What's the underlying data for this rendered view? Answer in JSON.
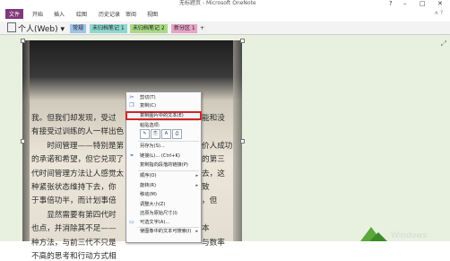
{
  "window": {
    "title": "无标题页 - Microsoft OneNote",
    "controls": [
      "?",
      "–",
      "□",
      "✕"
    ]
  },
  "ribbon": {
    "tabs": [
      "文件",
      "开始",
      "插入",
      "绘图",
      "历史记录",
      "审阅",
      "视图"
    ],
    "right_icons": "∧ ?"
  },
  "notebook": {
    "name": "个人(Web)",
    "sections": [
      {
        "label": "常规",
        "color": "#9fc3e8"
      },
      {
        "label": "未归档笔记 1",
        "color": "#8ed7cf"
      },
      {
        "label": "未归档笔记 2",
        "color": "#a9d986"
      },
      {
        "label": "新分区 1",
        "color": "#e6a4c8"
      },
      {
        "label": "+",
        "color": "#f0f0f0"
      }
    ]
  },
  "book": {
    "lines": [
      "我。但我们却发现，受过",
      "有接受过训练的人一样出色",
      "　　时间管理——特别是第",
      "的承诺和希望，但它兑现了",
      "代时间管理方法让人感觉太",
      "种紧张状态维持下去，你",
      "于事倍功半，而计划事倍",
      "　　显然需要有第四代时",
      "也点，并消除其不足——",
      "种方法，与前三代不只是",
      "不高的思考和行动方式相"
    ],
    "right_lines": [
      "能和没",
      "",
      "价人成功",
      "的第三",
      "去，这",
      "致",
      "，但",
      "",
      "本",
      "与数率",
      ""
    ]
  },
  "context_menu": {
    "items": [
      {
        "icon": "cut-icon",
        "glyph": "✂",
        "label": "剪切(T)",
        "disabled": false
      },
      {
        "icon": "copy-icon",
        "glyph": "❐",
        "label": "复制(C)",
        "disabled": false
      },
      {
        "icon": "",
        "glyph": "",
        "label": "复制图片中的文本(E)",
        "disabled": false,
        "highlight": true
      },
      {
        "icon": "",
        "glyph": "",
        "label": "粘贴选项:",
        "disabled": false
      },
      {
        "icon": "paste-options-icon",
        "glyph": "",
        "label": "",
        "disabled": false,
        "paste": [
          "✎",
          "⎘",
          "A",
          "⎙"
        ]
      },
      {
        "icon": "",
        "glyph": "",
        "label": "另存为(S)...",
        "disabled": false
      },
      {
        "icon": "link-icon",
        "glyph": "⚭",
        "label": "链接(L)... (Ctrl+K)",
        "disabled": false
      },
      {
        "icon": "",
        "glyph": "",
        "label": "复制指向段落的链接(P)",
        "disabled": false
      },
      {
        "icon": "",
        "glyph": "",
        "label": "顺序(O)",
        "disabled": false,
        "arrow": true
      },
      {
        "icon": "",
        "glyph": "",
        "label": "旋转(R)",
        "disabled": false,
        "arrow": true
      },
      {
        "icon": "",
        "glyph": "",
        "label": "移动(M)",
        "disabled": false
      },
      {
        "icon": "",
        "glyph": "",
        "label": "调整大小(Z)",
        "disabled": false
      },
      {
        "icon": "",
        "glyph": "",
        "label": "还原为原始尺寸(I)",
        "disabled": false
      },
      {
        "icon": "alt-text-icon",
        "glyph": "▭",
        "label": "可选文字(A)...",
        "disabled": false
      },
      {
        "icon": "",
        "glyph": "",
        "label": "使图像中的文本可搜索(I)",
        "disabled": false,
        "arrow": true
      }
    ]
  },
  "colors": {
    "file_tab": "#80397b",
    "highlight": "#d22525",
    "canvas": "#e8f0e0"
  }
}
